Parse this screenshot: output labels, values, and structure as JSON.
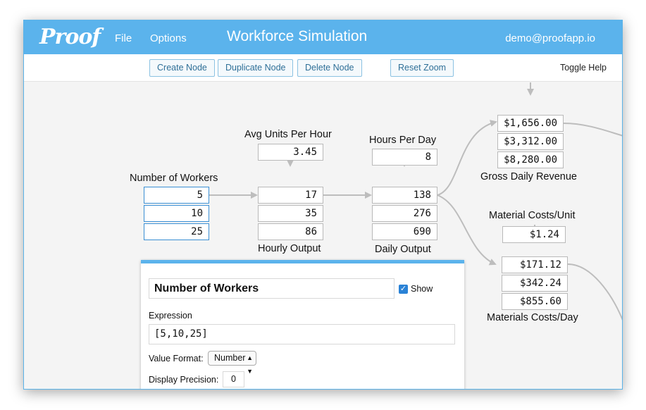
{
  "header": {
    "logo": "Proof",
    "menu": [
      "File",
      "Options"
    ],
    "title": "Workforce Simulation",
    "user_email": "demo@proofapp.io"
  },
  "toolbar": {
    "create": "Create Node",
    "duplicate": "Duplicate Node",
    "delete": "Delete Node",
    "reset_zoom": "Reset Zoom",
    "toggle_help": "Toggle Help"
  },
  "nodes": {
    "workers": {
      "label": "Number of Workers",
      "values": [
        "5",
        "10",
        "25"
      ]
    },
    "avg_units": {
      "label": "Avg Units Per Hour",
      "value": "3.45"
    },
    "hourly": {
      "label": "Hourly Output",
      "values": [
        "17",
        "35",
        "86"
      ]
    },
    "hours_day": {
      "label": "Hours Per Day",
      "value": "8"
    },
    "daily": {
      "label": "Daily Output",
      "values": [
        "138",
        "276",
        "690"
      ]
    },
    "gross": {
      "label": "Gross Daily Revenue",
      "values": [
        "$1,656.00",
        "$3,312.00",
        "$8,280.00"
      ]
    },
    "mat_unit": {
      "label": "Material Costs/Unit",
      "value": "$1.24"
    },
    "mat_day": {
      "label": "Materials Costs/Day",
      "values": [
        "$171.12",
        "$342.24",
        "$855.60"
      ]
    }
  },
  "panel": {
    "name": "Number of Workers",
    "show_label": "Show",
    "show_checked": true,
    "expression_label": "Expression",
    "expression": "[5,10,25]",
    "format_label": "Value Format:",
    "format_value": "Number",
    "precision_label": "Display Precision:",
    "precision_value": "0"
  },
  "colors": {
    "brand": "#5bb3ec",
    "selected_border": "#3a8fd4",
    "edge": "#bdbdbd"
  }
}
